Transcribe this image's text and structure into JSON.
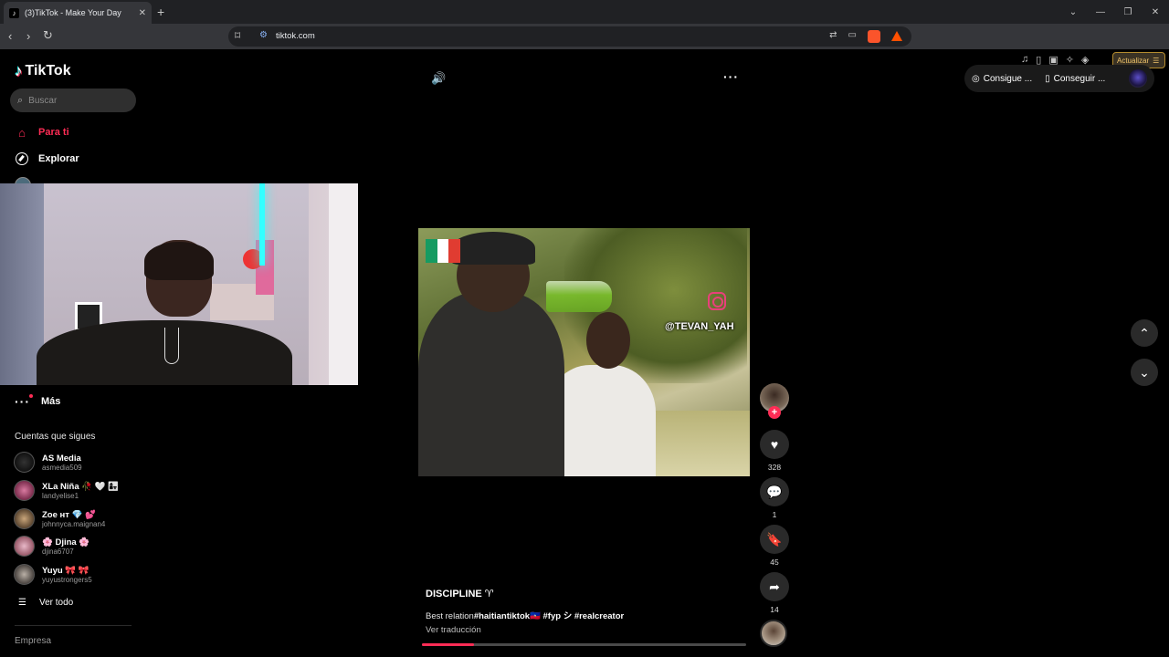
{
  "browser": {
    "tab_title": "(3)TikTok - Make Your Day",
    "url": "tiktok.com",
    "update_label": "Actualizar"
  },
  "sidebar": {
    "logo_text": "TikTok",
    "search_placeholder": "Buscar",
    "nav": [
      {
        "label": "Para ti",
        "icon": "home-icon",
        "active": true
      },
      {
        "label": "Explorar",
        "icon": "compass-icon",
        "active": false
      }
    ],
    "more_label": "Más",
    "following_header": "Cuentas que sigues",
    "accounts": [
      {
        "name": "AS Media",
        "handle": "asmedia509"
      },
      {
        "name": "XLa Niña 🥀 🤍 👩‍👧",
        "handle": "landyelise1"
      },
      {
        "name": "Zoe ʜᴛ 💎 💕",
        "handle": "johnnyca.maignan4"
      },
      {
        "name": "🌸 Djina 🌸",
        "handle": "djina6707"
      },
      {
        "name": "Yuyu 🎀 🎀",
        "handle": "yuyustrongers5"
      }
    ],
    "see_all": "Ver todo",
    "company": "Empresa"
  },
  "topbar": {
    "get_coins": "Consigue ...",
    "get_app": "Conseguir ..."
  },
  "video": {
    "overlay_handle": "@TEVAN_YAH",
    "title": "DISCIPLINE ♈",
    "description_prefix": "Best relation",
    "description_tags": "#haitiantiktok🇭🇹 #fyp シ #realcreator",
    "translate_label": "Ver traducción",
    "progress": 0.16
  },
  "actions": {
    "likes": "328",
    "comments": "1",
    "saves": "45",
    "shares": "14"
  },
  "colors": {
    "accent": "#fe2c55",
    "background": "#000000",
    "button_bg": "#2a2a2a"
  }
}
